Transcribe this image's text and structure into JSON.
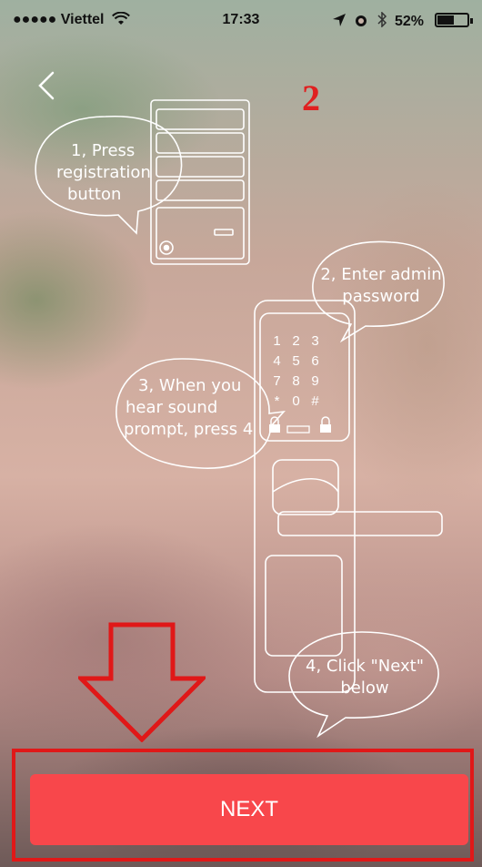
{
  "status_bar": {
    "carrier": "●●●●● Viettel",
    "time": "17:33",
    "battery_percent": "52%"
  },
  "step": {
    "number": "2"
  },
  "instructions": {
    "step1_line1": "1, Press",
    "step1_line2": "registration",
    "step1_line3": "button",
    "step2_line1": "2, Enter admin",
    "step2_line2": "password",
    "step3_line1": "3, When you",
    "step3_line2": "hear sound",
    "step3_line3": "prompt, press 4",
    "step4_line1": "4, Click \"Next\"",
    "step4_line2": "below"
  },
  "keypad": {
    "rows": [
      [
        "1",
        "2",
        "3"
      ],
      [
        "4",
        "5",
        "6"
      ],
      [
        "7",
        "8",
        "9"
      ],
      [
        "*",
        "0",
        "#"
      ]
    ]
  },
  "next_button": {
    "label": "NEXT"
  },
  "colors": {
    "accent": "#f8474b",
    "annotation_red": "#e01818"
  },
  "icons": {
    "back": "chevron-left-icon",
    "wifi": "wifi-icon",
    "location": "location-arrow-icon",
    "alarm": "alarm-icon",
    "bluetooth": "bluetooth-icon",
    "battery": "battery-icon"
  }
}
